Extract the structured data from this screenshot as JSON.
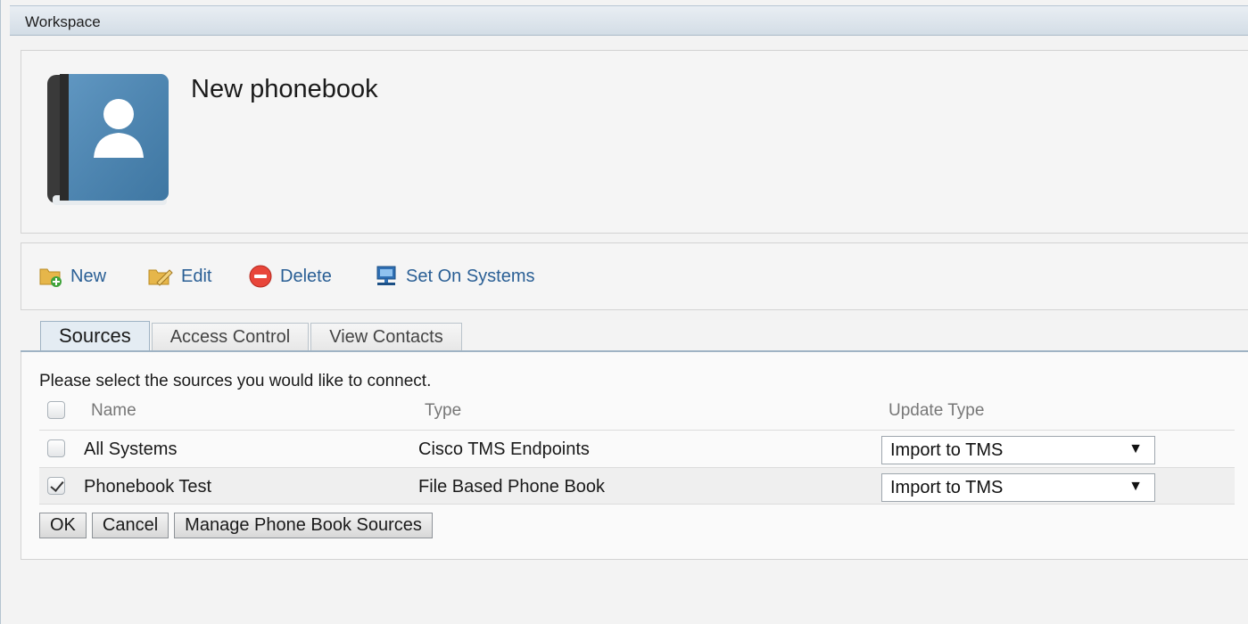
{
  "workspace": {
    "title": "Workspace"
  },
  "header": {
    "title": "New phonebook"
  },
  "toolbar": {
    "new_label": "New",
    "edit_label": "Edit",
    "delete_label": "Delete",
    "set_on_systems_label": "Set On Systems"
  },
  "tabs": [
    {
      "label": "Sources",
      "active": true
    },
    {
      "label": "Access Control",
      "active": false
    },
    {
      "label": "View Contacts",
      "active": false
    }
  ],
  "sources": {
    "instruction": "Please select the sources you would like to connect.",
    "columns": {
      "name": "Name",
      "type": "Type",
      "update_type": "Update Type"
    },
    "rows": [
      {
        "name": "All Systems",
        "type": "Cisco TMS Endpoints",
        "update_type": "Import to TMS",
        "checked": false
      },
      {
        "name": "Phonebook Test",
        "type": "File Based Phone Book",
        "update_type": "Import to TMS",
        "checked": true
      }
    ]
  },
  "buttons": {
    "ok": "OK",
    "cancel": "Cancel",
    "manage": "Manage Phone Book Sources"
  },
  "icons": {
    "phonebook": "phonebook-icon",
    "new": "folder-add-icon",
    "edit": "folder-edit-icon",
    "delete": "delete-icon",
    "set_on_systems": "monitor-icon"
  },
  "colors": {
    "link": "#2a5f95",
    "book_cover": "#4f88b5",
    "delete_red": "#e8463a"
  }
}
